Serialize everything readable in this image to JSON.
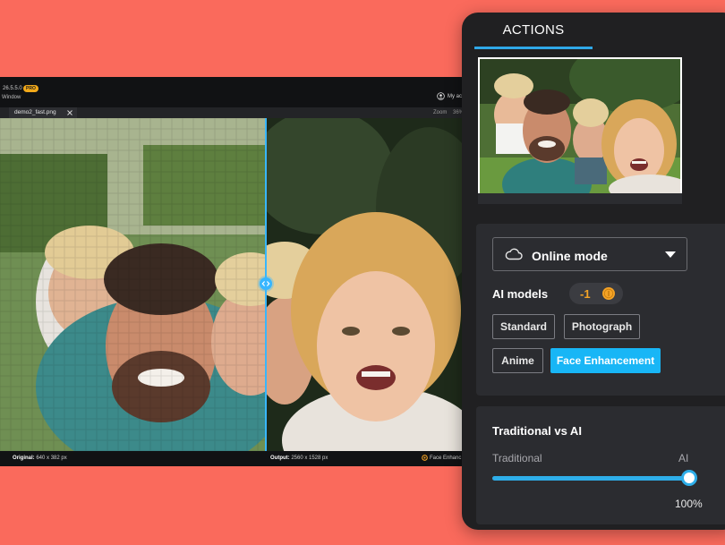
{
  "app": {
    "version": "26.5.5.0",
    "pro_badge": "PRO",
    "menu_label": "Window",
    "account_label": "My ac",
    "file_tab": "demo2_fast.png",
    "zoom_label": "Zoom",
    "zoom_value": "36%"
  },
  "infobar": {
    "original_label": "Original:",
    "original_size": "640 x 382 px",
    "output_label": "Output:",
    "output_size": "2560 x 1528 px",
    "mode_label": "Face Enhanc"
  },
  "actions": {
    "tab_label": "ACTIONS",
    "mode": {
      "selected": "Online mode"
    },
    "models_label": "AI models",
    "cost": "-1",
    "models": [
      {
        "label": "Standard",
        "selected": false
      },
      {
        "label": "Photograph",
        "selected": false
      },
      {
        "label": "Anime",
        "selected": false
      },
      {
        "label": "Face Enhancement",
        "selected": true
      }
    ],
    "slider": {
      "title": "Traditional vs AI",
      "left_label": "Traditional",
      "right_label": "AI",
      "value_percent": 100,
      "value_text": "100%"
    }
  },
  "colors": {
    "background": "#fa6a5c",
    "accent": "#18b6f6",
    "cost": "#f4a326"
  },
  "icons": {
    "mode": "cloud-icon",
    "dropdown": "caret-down-icon",
    "cost": "coin-icon",
    "compare": "compare-handle-icon",
    "account": "account-icon"
  }
}
